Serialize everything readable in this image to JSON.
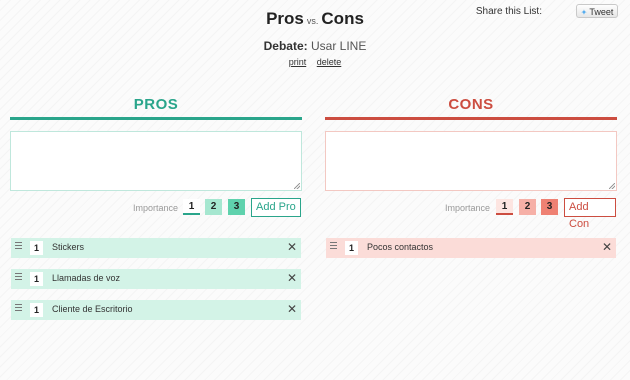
{
  "header": {
    "title_pros": "Pros",
    "title_vs": "vs.",
    "title_cons": "Cons",
    "share_label": "Share this List:",
    "tweet_label": "Tweet",
    "debate_label": "Debate:",
    "debate_topic": "Usar LINE",
    "print_link": "print",
    "delete_link": "delete"
  },
  "pros": {
    "heading": "PROS",
    "accent_color": "#2aa58b",
    "importance_label": "Importance",
    "importance_options": [
      "1",
      "2",
      "3"
    ],
    "selected_importance": "1",
    "add_button": "Add Pro",
    "input_value": "",
    "items": [
      {
        "importance": "1",
        "text": "Stickers",
        "remove": "✕"
      },
      {
        "importance": "1",
        "text": "Llamadas de voz",
        "remove": "✕"
      },
      {
        "importance": "1",
        "text": "Cliente de Escritorio",
        "remove": "✕"
      }
    ]
  },
  "cons": {
    "heading": "CONS",
    "accent_color": "#cc4d40",
    "importance_label": "Importance",
    "importance_options": [
      "1",
      "2",
      "3"
    ],
    "selected_importance": "1",
    "add_button": "Add Con",
    "input_value": "",
    "items": [
      {
        "importance": "1",
        "text": "Pocos contactos",
        "remove": "✕"
      }
    ]
  }
}
